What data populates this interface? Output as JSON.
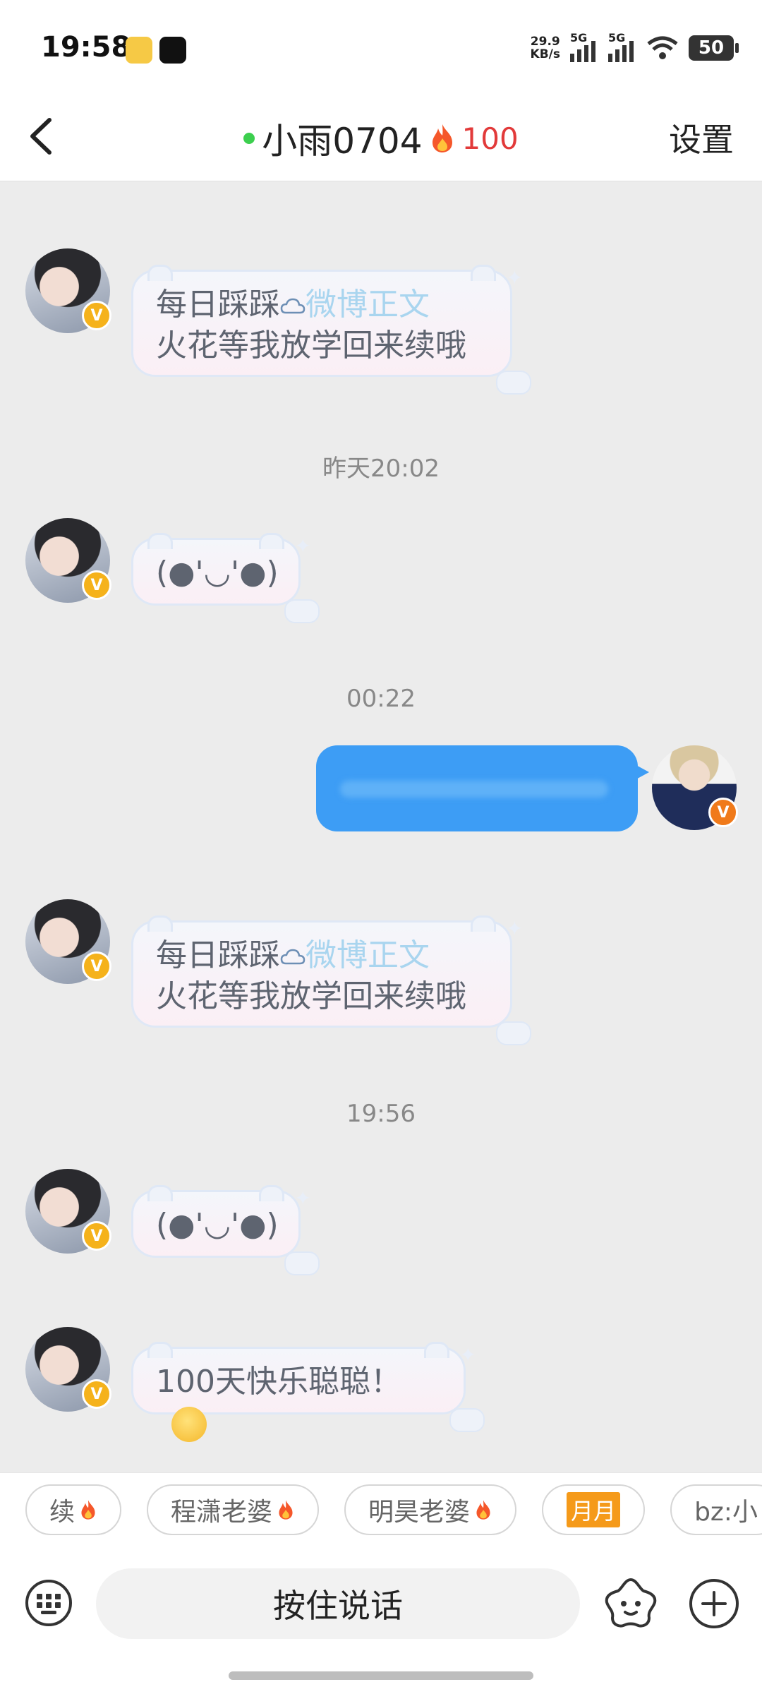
{
  "status_bar": {
    "time": "19:58",
    "net_speed_value": "29.9",
    "net_speed_unit": "KB/s",
    "signal1_label": "5G",
    "signal2_label": "5G",
    "battery": "50"
  },
  "header": {
    "title": "小雨0704",
    "spark_count": "100",
    "settings_label": "设置"
  },
  "messages": [
    {
      "line1_prefix": "每日踩踩",
      "line1_link": "微博正文",
      "line2": "火花等我放学回来续哦"
    },
    {
      "timestamp": "昨天20:02"
    },
    {
      "text": "(●'◡'●)"
    },
    {
      "timestamp": "00:22"
    },
    {
      "outgoing": "blurred"
    },
    {
      "line1_prefix": "每日踩踩",
      "line1_link": "微博正文",
      "line2": "火花等我放学回来续哦"
    },
    {
      "timestamp": "19:56"
    },
    {
      "text": "(●'◡'●)"
    },
    {
      "text": "100天快乐聪聪！"
    }
  ],
  "quick_replies": [
    "续",
    "程潇老婆",
    "明昊老婆",
    "月月",
    "bz:小"
  ],
  "input": {
    "voice_label": "按住说话"
  },
  "colors": {
    "accent_blue": "#3d9df5",
    "link": "#a9d5ef",
    "spark_red": "#e23a3a",
    "online_green": "#3ccf4e"
  }
}
